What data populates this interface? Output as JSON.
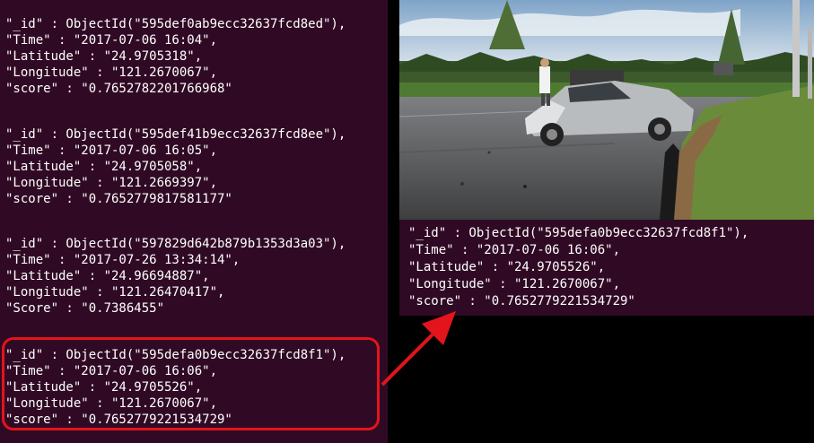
{
  "records": [
    {
      "id_line": "\"_id\" : ObjectId(\"595def0ab9ecc32637fcd8ed\"),",
      "time_line": "\"Time\" : \"2017-07-06 16:04\",",
      "lat_line": "\"Latitude\" : \"24.9705318\",",
      "lon_line": "\"Longitude\" : \"121.2670067\",",
      "score_line": "\"score\" : \"0.7652782201766968\""
    },
    {
      "id_line": "\"_id\" : ObjectId(\"595def41b9ecc32637fcd8ee\"),",
      "time_line": "\"Time\" : \"2017-07-06 16:05\",",
      "lat_line": "\"Latitude\" : \"24.9705058\",",
      "lon_line": "\"Longitude\" : \"121.2669397\",",
      "score_line": "\"score\" : \"0.7652779817581177\""
    },
    {
      "id_line": "\"_id\" : ObjectId(\"597829d642b879b1353d3a03\"),",
      "time_line": "\"Time\" : \"2017-07-26 13:34:14\",",
      "lat_line": "\"Latitude\" : \"24.96694887\",",
      "lon_line": "\"Longitude\" : \"121.26470417\",",
      "score_line": "\"Score\" : \"0.7386455\""
    },
    {
      "id_line": "\"_id\" : ObjectId(\"595defa0b9ecc32637fcd8f1\"),",
      "time_line": "\"Time\" : \"2017-07-06 16:06\",",
      "lat_line": "\"Latitude\" : \"24.9705526\",",
      "lon_line": "\"Longitude\" : \"121.2670067\",",
      "score_line": "\"score\" : \"0.7652779221534729\""
    }
  ],
  "detail": {
    "id_line": "\"_id\" : ObjectId(\"595defa0b9ecc32637fcd8f1\"),",
    "time_line": "\"Time\" : \"2017-07-06 16:06\",",
    "lat_line": "\"Latitude\" : \"24.9705526\",",
    "lon_line": "\"Longitude\" : \"121.2670067\",",
    "score_line": "\"score\" : \"0.7652779221534729\""
  },
  "colors": {
    "terminal_bg": "#300a24",
    "text": "#ffffff",
    "highlight": "#e3141c"
  },
  "icons": {
    "arrow": "red-diagonal-arrow-icon"
  }
}
